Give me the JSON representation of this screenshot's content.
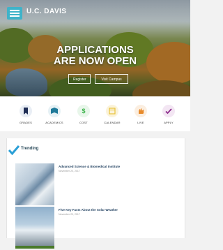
{
  "header": {
    "brand": "U.C. DAVIS",
    "menu_icon": "hamburger-menu-icon"
  },
  "hero": {
    "headline_line1": "APPLICATIONS",
    "headline_line2": "ARE NOW OPEN",
    "button1_label": "Register",
    "button2_label": "Visit Campus"
  },
  "quick_links": [
    {
      "label": "GRADES",
      "icon": "bookmark-icon",
      "color": "#1f2d55"
    },
    {
      "label": "ACADEMICS",
      "icon": "book-icon",
      "color": "#1f7a9a"
    },
    {
      "label": "COST",
      "icon": "dollar-icon",
      "color": "#3bb34a"
    },
    {
      "label": "CALENDAR",
      "icon": "calendar-icon",
      "color": "#e8c23a"
    },
    {
      "label": "LIVE",
      "icon": "hand-icon",
      "color": "#e88a2a"
    },
    {
      "label": "APPLY",
      "icon": "checkmark-icon",
      "color": "#8a2a8a"
    }
  ],
  "trending": {
    "title": "Trending",
    "icon": "checkmark-icon",
    "stories": [
      {
        "title": "Advanced Science & Biomedical Institute",
        "date": "November 20, 2017"
      },
      {
        "title": "Five Key Facts About the Solar Weather",
        "date": "November 20, 2017"
      }
    ]
  }
}
